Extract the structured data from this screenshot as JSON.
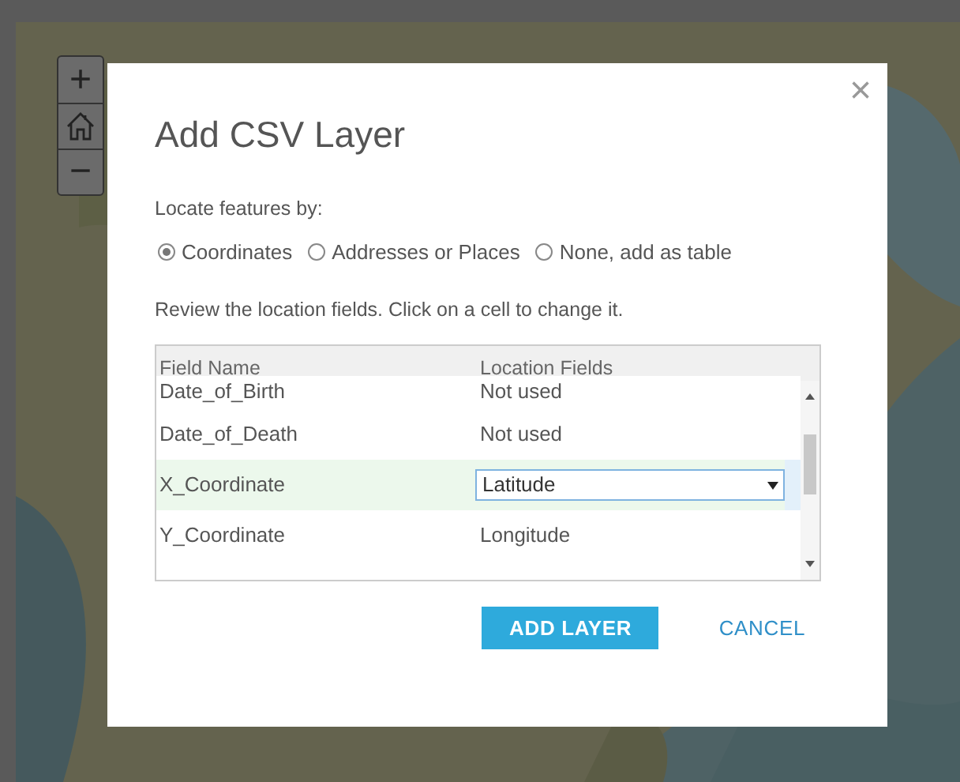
{
  "zoom_controls": [
    {
      "kind": "zoom_in",
      "label": "+"
    },
    {
      "kind": "home"
    },
    {
      "kind": "zoom_out",
      "label": "−"
    }
  ],
  "dialog": {
    "title": "Add CSV Layer",
    "close": "×",
    "locate_label": "Locate features by:",
    "location_options": [
      {
        "label": "Coordinates",
        "selected": true
      },
      {
        "label": "Addresses or Places",
        "selected": false
      },
      {
        "label": "None, add as table",
        "selected": false
      }
    ],
    "review_hint": "Review the location fields. Click on a cell to change it.",
    "table": {
      "columns": [
        "Field Name",
        "Location Fields"
      ],
      "rows": [
        {
          "field": "Date_of_Birth",
          "location": "Not used",
          "kind": "text",
          "selected": false
        },
        {
          "field": "Date_of_Death",
          "location": "Not used",
          "kind": "text",
          "selected": false
        },
        {
          "field": "X_Coordinate",
          "location": "Latitude",
          "kind": "select",
          "selected": true
        },
        {
          "field": "Y_Coordinate",
          "location": "Longitude",
          "kind": "text",
          "selected": false
        }
      ]
    },
    "buttons": [
      {
        "label": "ADD LAYER",
        "kind": "primary"
      },
      {
        "label": "CANCEL",
        "kind": "link"
      }
    ]
  }
}
